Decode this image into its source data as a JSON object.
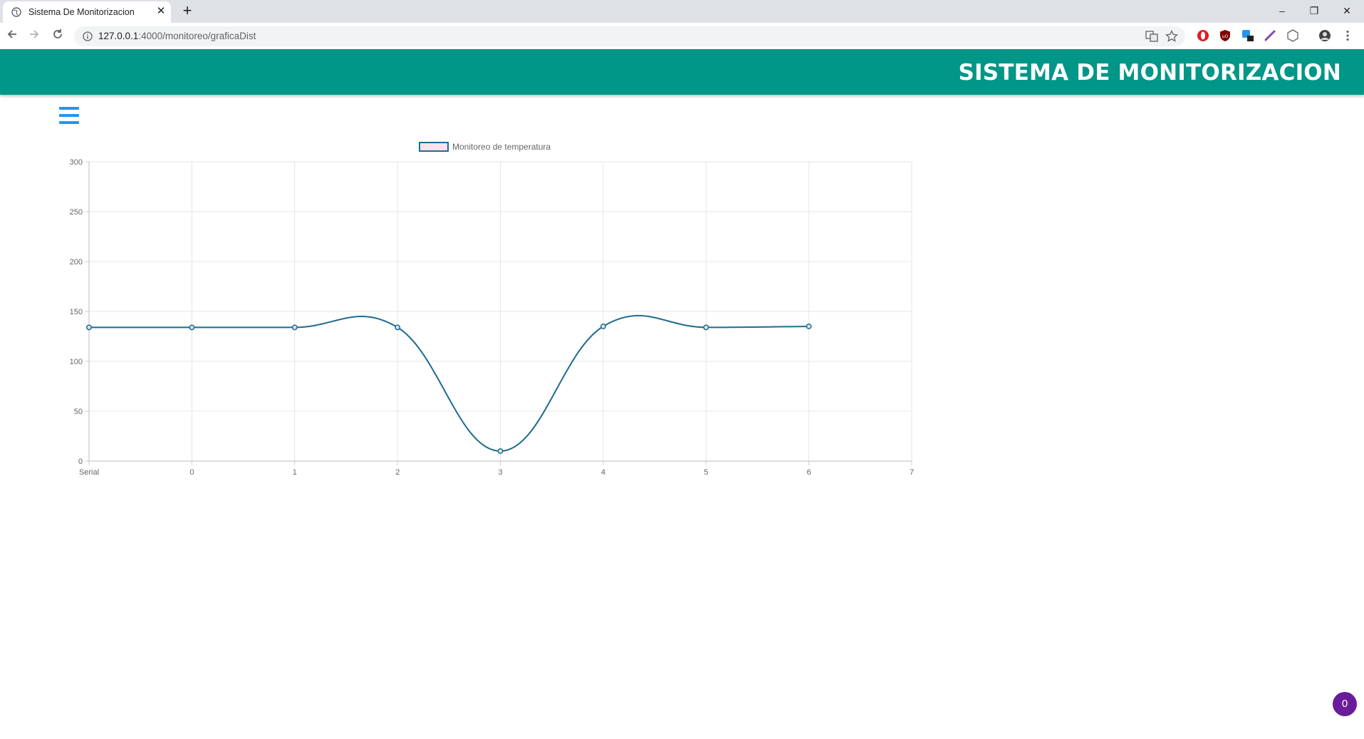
{
  "browser": {
    "tab_title": "Sistema De Monitorizacion",
    "tab_close": "✕",
    "new_tab": "+",
    "url_host": "127.0.0.1",
    "url_rest": ":4000/monitoreo/graficaDist",
    "window_controls": {
      "minimize": "–",
      "restore": "❐",
      "close": "✕"
    }
  },
  "app": {
    "title": "SISTEMA DE MONITORIZACION",
    "notification_count": "0"
  },
  "colors": {
    "header": "#009688",
    "menu_icon": "#2196f3",
    "line": "#1e6b8f",
    "legend_fill": "#fde2ea",
    "fab": "#6a1b9a"
  },
  "chart_data": {
    "type": "line",
    "legend": [
      "Monitoreo de temperatura"
    ],
    "legend_position": "top",
    "categories": [
      "Serial",
      "0",
      "1",
      "2",
      "3",
      "4",
      "5",
      "6",
      "7"
    ],
    "series": [
      {
        "name": "Monitoreo de temperatura",
        "values": [
          134,
          134,
          134,
          134,
          10,
          135,
          134,
          135
        ]
      }
    ],
    "ylim": [
      0,
      300
    ],
    "yticks": [
      0,
      50,
      100,
      150,
      200,
      250,
      300
    ],
    "grid": true,
    "curve": "smooth"
  }
}
